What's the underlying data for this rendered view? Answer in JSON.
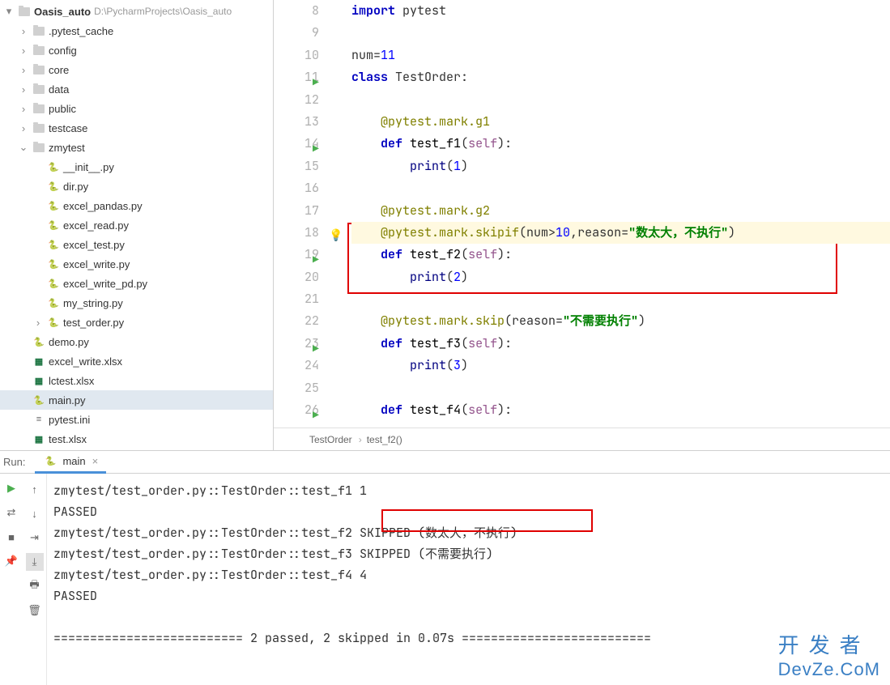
{
  "project": {
    "root_name": "Oasis_auto",
    "root_path": "D:\\PycharmProjects\\Oasis_auto",
    "tree": [
      {
        "depth": 1,
        "arrow": "right",
        "icon": "folder",
        "label": ".pytest_cache"
      },
      {
        "depth": 1,
        "arrow": "right",
        "icon": "folder",
        "label": "config"
      },
      {
        "depth": 1,
        "arrow": "right",
        "icon": "folder",
        "label": "core"
      },
      {
        "depth": 1,
        "arrow": "right",
        "icon": "folder",
        "label": "data"
      },
      {
        "depth": 1,
        "arrow": "right",
        "icon": "folder",
        "label": "public"
      },
      {
        "depth": 1,
        "arrow": "right",
        "icon": "folder",
        "label": "testcase"
      },
      {
        "depth": 1,
        "arrow": "down",
        "icon": "folder",
        "label": "zmytest"
      },
      {
        "depth": 2,
        "arrow": "none",
        "icon": "py",
        "label": "__init__.py"
      },
      {
        "depth": 2,
        "arrow": "none",
        "icon": "py",
        "label": "dir.py"
      },
      {
        "depth": 2,
        "arrow": "none",
        "icon": "py",
        "label": "excel_pandas.py"
      },
      {
        "depth": 2,
        "arrow": "none",
        "icon": "py",
        "label": "excel_read.py"
      },
      {
        "depth": 2,
        "arrow": "none",
        "icon": "py",
        "label": "excel_test.py"
      },
      {
        "depth": 2,
        "arrow": "none",
        "icon": "py",
        "label": "excel_write.py"
      },
      {
        "depth": 2,
        "arrow": "none",
        "icon": "py",
        "label": "excel_write_pd.py"
      },
      {
        "depth": 2,
        "arrow": "none",
        "icon": "py",
        "label": "my_string.py"
      },
      {
        "depth": 2,
        "arrow": "right",
        "icon": "py",
        "label": "test_order.py"
      },
      {
        "depth": 1,
        "arrow": "none",
        "icon": "py",
        "label": "demo.py"
      },
      {
        "depth": 1,
        "arrow": "none",
        "icon": "xlsx",
        "label": "excel_write.xlsx"
      },
      {
        "depth": 1,
        "arrow": "none",
        "icon": "xlsx",
        "label": "lctest.xlsx"
      },
      {
        "depth": 1,
        "arrow": "none",
        "icon": "py",
        "label": "main.py",
        "selected": true
      },
      {
        "depth": 1,
        "arrow": "none",
        "icon": "ini",
        "label": "pytest.ini"
      },
      {
        "depth": 1,
        "arrow": "none",
        "icon": "xlsx",
        "label": "test.xlsx"
      }
    ]
  },
  "editor": {
    "lines": [
      {
        "n": 8,
        "run": false,
        "hl": false,
        "html": "<span class='kw'>import</span> pytest"
      },
      {
        "n": 9,
        "run": false,
        "hl": false,
        "html": ""
      },
      {
        "n": 10,
        "run": false,
        "hl": false,
        "html": "num=<span class='num'>11</span>"
      },
      {
        "n": 11,
        "run": true,
        "hl": false,
        "html": "<span class='kw'>class</span> TestOrder:"
      },
      {
        "n": 12,
        "run": false,
        "hl": false,
        "html": ""
      },
      {
        "n": 13,
        "run": false,
        "hl": false,
        "html": "    <span class='dec'>@pytest.mark.g1</span>"
      },
      {
        "n": 14,
        "run": true,
        "hl": false,
        "html": "    <span class='kw'>def</span> <span class='fn'>test_f1</span>(<span class='self'>self</span>):"
      },
      {
        "n": 15,
        "run": false,
        "hl": false,
        "html": "        <span class='builtin'>print</span>(<span class='num'>1</span>)"
      },
      {
        "n": 16,
        "run": false,
        "hl": false,
        "html": ""
      },
      {
        "n": 17,
        "run": false,
        "hl": false,
        "html": "    <span class='dec'>@pytest.mark.g2</span>"
      },
      {
        "n": 18,
        "run": false,
        "hl": true,
        "bulb": true,
        "html": "    <span class='dec'>@pytest.mark.skipif</span>(num&gt;<span class='num'>10</span>,reason=<span class='str'>\"数太大，不执行\"</span>)"
      },
      {
        "n": 19,
        "run": true,
        "hl": false,
        "html": "    <span class='kw'>def</span> <span class='fn'>test_f2</span>(<span class='self'>self</span>):"
      },
      {
        "n": 20,
        "run": false,
        "hl": false,
        "html": "        <span class='builtin'>print</span>(<span class='num'>2</span>)"
      },
      {
        "n": 21,
        "run": false,
        "hl": false,
        "html": ""
      },
      {
        "n": 22,
        "run": false,
        "hl": false,
        "html": "    <span class='dec'>@pytest.mark.skip</span>(reason=<span class='str'>\"不需要执行\"</span>)"
      },
      {
        "n": 23,
        "run": true,
        "hl": false,
        "html": "    <span class='kw'>def</span> <span class='fn'>test_f3</span>(<span class='self'>self</span>):"
      },
      {
        "n": 24,
        "run": false,
        "hl": false,
        "html": "        <span class='builtin'>print</span>(<span class='num'>3</span>)"
      },
      {
        "n": 25,
        "run": false,
        "hl": false,
        "html": ""
      },
      {
        "n": 26,
        "run": true,
        "hl": false,
        "html": "    <span class='kw'>def</span> <span class='fn'>test_f4</span>(<span class='self'>self</span>):"
      }
    ],
    "breadcrumb": [
      "TestOrder",
      "test_f2()"
    ]
  },
  "run": {
    "panel_label": "Run:",
    "tab_name": "main",
    "output": "zmytest/test_order.py::TestOrder::test_f1 1\nPASSED\nzmytest/test_order.py::TestOrder::test_f2 SKIPPED (数太大，不执行)\nzmytest/test_order.py::TestOrder::test_f3 SKIPPED (不需要执行)\nzmytest/test_order.py::TestOrder::test_f4 4\nPASSED\n\n========================== 2 passed, 2 skipped in 0.07s =========================="
  },
  "watermark": {
    "cn": "开发者",
    "en": "DevZe.CoM"
  }
}
